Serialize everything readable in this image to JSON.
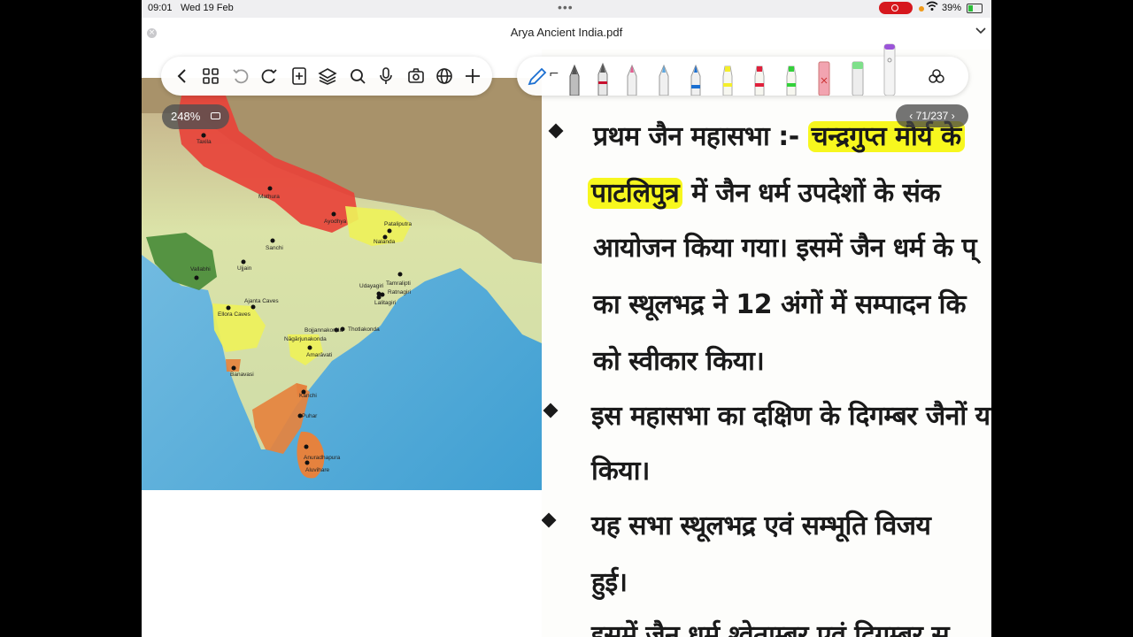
{
  "status_bar": {
    "time": "09:01",
    "date": "Wed 19 Feb",
    "battery": "39%"
  },
  "app": {
    "title": "Arya Ancient India.pdf"
  },
  "viewer": {
    "zoom": "248%",
    "page": "71/237"
  },
  "toolbar": {
    "icons": [
      "back-icon",
      "thumbnails-icon",
      "undo-icon",
      "redo-icon",
      "add-page-icon",
      "layers-icon",
      "search-icon",
      "microphone-icon",
      "camera-icon",
      "globe-icon",
      "add-icon"
    ],
    "pens": [
      {
        "name": "fountain-pen",
        "color": "#555555"
      },
      {
        "name": "pen-red",
        "color": "#c8102e"
      },
      {
        "name": "pen-pink",
        "color": "#e35b8f"
      },
      {
        "name": "pen-light-blue",
        "color": "#5aa7e0"
      },
      {
        "name": "pen-blue",
        "color": "#1b6fd1"
      },
      {
        "name": "highlighter-yellow",
        "color": "#f4ee2b"
      },
      {
        "name": "highlighter-red",
        "color": "#e0213c"
      },
      {
        "name": "highlighter-green",
        "color": "#33d13a"
      },
      {
        "name": "eraser-pink",
        "color": "#f2a4b0"
      },
      {
        "name": "eraser-green",
        "color": "#7ee08a"
      },
      {
        "name": "pen-purple",
        "color": "#9b54d9"
      }
    ]
  },
  "map": {
    "labels": [
      "Taxila",
      "Mathura",
      "Ayodhya",
      "Pataliputra",
      "Nalanda",
      "Sanchi",
      "Vallabhi",
      "Ujjain",
      "Ajanta Caves",
      "Ellora Caves",
      "Udayagiri",
      "Tamralipti",
      "Ratnagiri",
      "Lalitagiri",
      "Bojjannakonda",
      "Thotlakonda",
      "Nāgārjunakonda",
      "Amarāvati",
      "Banavasi",
      "Kānchi",
      "Puhar",
      "Anuradhapura",
      "Aluvihare"
    ]
  },
  "document": {
    "lines": [
      {
        "text": "प्रथम जैन महासभा :- ",
        "hl": "चन्द्रगुप्त मौर्य के"
      },
      {
        "hl": "पाटलिपुत्र",
        "text": " में जैन धर्म उपदेशों के संक"
      },
      {
        "text": "आयोजन किया गया। इसमें जैन धर्म के प्"
      },
      {
        "text": "का स्थूलभद्र ने 12 अंगों में सम्पादन कि"
      },
      {
        "text": "को स्वीकार किया।"
      },
      {
        "text": "इस महासभा का दक्षिण के दिगम्बर जैनों य"
      },
      {
        "text": "किया।"
      },
      {
        "text": "यह सभा स्थूलभद्र एवं सम्भूति विजय "
      },
      {
        "text": "हुई।"
      },
      {
        "text": "इसमें जैन धर्म श्वेताम्बर एवं दिगम्बर स"
      }
    ]
  }
}
